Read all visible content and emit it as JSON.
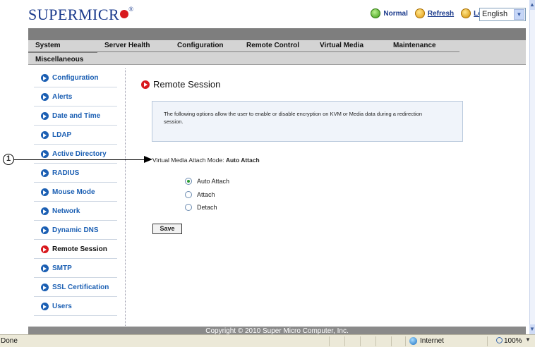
{
  "header": {
    "logo_text": "SUPERMICR",
    "logo_reg": "®",
    "status_label": "Normal",
    "refresh_label": "Refresh",
    "logout_label": "Logout",
    "language": "English"
  },
  "nav": {
    "tabs": [
      "System",
      "Server Health",
      "Configuration",
      "Remote Control",
      "Virtual Media",
      "Maintenance"
    ],
    "misc": "Miscellaneous"
  },
  "sidebar": {
    "items": [
      {
        "label": "Configuration"
      },
      {
        "label": "Alerts"
      },
      {
        "label": "Date and Time"
      },
      {
        "label": "LDAP"
      },
      {
        "label": "Active Directory"
      },
      {
        "label": "RADIUS"
      },
      {
        "label": "Mouse Mode"
      },
      {
        "label": "Network"
      },
      {
        "label": "Dynamic DNS"
      },
      {
        "label": "Remote Session"
      },
      {
        "label": "SMTP"
      },
      {
        "label": "SSL Certification"
      },
      {
        "label": "Users"
      }
    ],
    "active": "Remote Session"
  },
  "content": {
    "title": "Remote Session",
    "info_line1": "The following options allow the user to enable or disable encryption on KVM or Media data during a redirection",
    "info_line2": "session.",
    "mode_label": "Virtual Media Attach Mode:",
    "mode_value": "Auto Attach",
    "options": [
      "Auto Attach",
      "Attach",
      "Detach"
    ],
    "selected": "Auto Attach",
    "save_label": "Save"
  },
  "callout": {
    "number": "1"
  },
  "footer": {
    "copyright": "Copyright © 2010 Super Micro Computer, Inc."
  },
  "statusbar": {
    "left": "Done",
    "zone": "Internet",
    "zoom": "100%"
  }
}
